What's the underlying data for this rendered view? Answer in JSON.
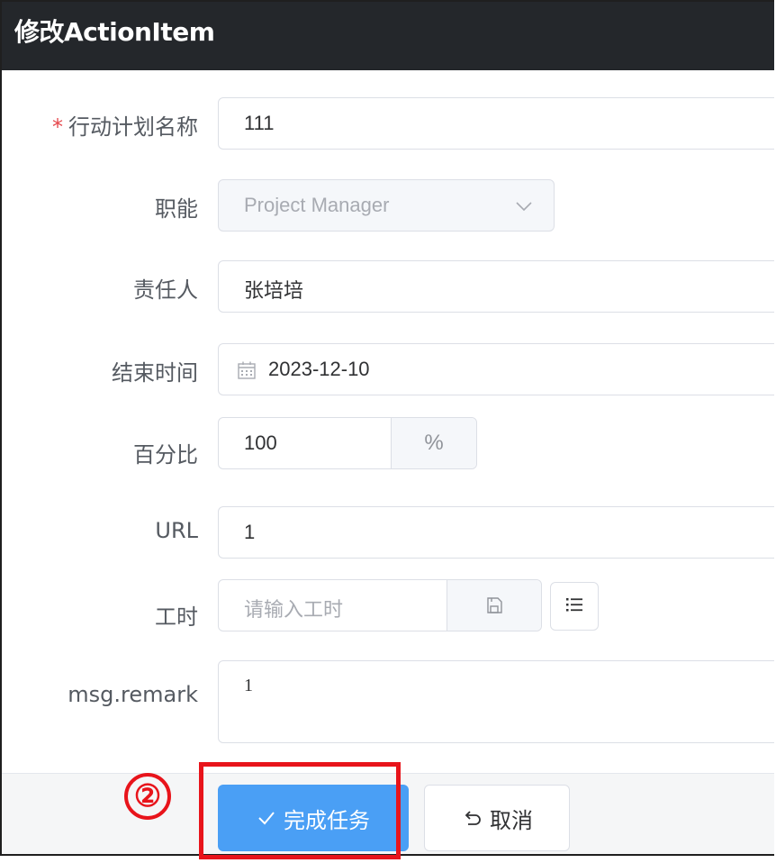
{
  "dialog": {
    "title": "修改ActionItem"
  },
  "form": {
    "action_plan_name": {
      "label": "行动计划名称",
      "required_mark": "*",
      "value": "111"
    },
    "function": {
      "label": "职能",
      "value": "Project Manager"
    },
    "owner": {
      "label": "责任人",
      "value": "张培培"
    },
    "end_time": {
      "label": "结束时间",
      "value": "2023-12-10"
    },
    "percentage": {
      "label": "百分比",
      "value": "100",
      "unit": "%"
    },
    "url": {
      "label": "URL",
      "value": "1"
    },
    "work_hours": {
      "label": "工时",
      "value": "",
      "placeholder": "请输入工时"
    },
    "remark": {
      "label": "msg.remark",
      "value": "1"
    }
  },
  "footer": {
    "complete_label": "完成任务",
    "cancel_label": "取消"
  },
  "annotation": {
    "step_marker": "②"
  },
  "icons": {
    "calendar": "calendar-icon",
    "chevron": "chevron-down-icon",
    "save": "save-icon",
    "list": "list-icon",
    "check": "check-icon",
    "undo": "undo-icon"
  },
  "colors": {
    "titlebar": "#24272b",
    "primary": "#4a9ff5",
    "highlight": "#e8141b",
    "required": "#e5484d"
  }
}
